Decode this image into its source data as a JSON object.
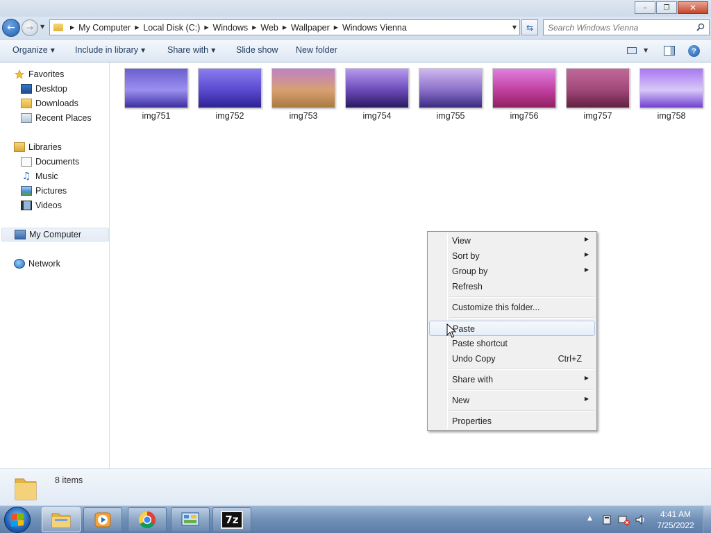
{
  "window": {
    "buttons": {
      "minimize": "minimize",
      "maximize": "maximize",
      "close": "close"
    }
  },
  "address": {
    "crumbs": [
      "My Computer",
      "Local Disk (C:)",
      "Windows",
      "Web",
      "Wallpaper",
      "Windows Vienna"
    ],
    "search_placeholder": "Search Windows Vienna"
  },
  "toolbar": {
    "organize": "Organize",
    "include_in_library": "Include in library",
    "share_with": "Share with",
    "slide_show": "Slide show",
    "new_folder": "New folder"
  },
  "nav": {
    "favorites": "Favorites",
    "desktop": "Desktop",
    "downloads": "Downloads",
    "recent_places": "Recent Places",
    "libraries": "Libraries",
    "documents": "Documents",
    "music": "Music",
    "pictures": "Pictures",
    "videos": "Videos",
    "my_computer": "My Computer",
    "network": "Network"
  },
  "files": [
    {
      "name": "img751",
      "colors": [
        "#6a5fd0",
        "#9c8ff0",
        "#3c2fa0"
      ]
    },
    {
      "name": "img752",
      "colors": [
        "#8a7cf0",
        "#5a4ad0",
        "#2e2290"
      ]
    },
    {
      "name": "img753",
      "colors": [
        "#c080c8",
        "#d8a070",
        "#a87a40"
      ]
    },
    {
      "name": "img754",
      "colors": [
        "#b89af0",
        "#6a4ab8",
        "#2a1a60"
      ]
    },
    {
      "name": "img755",
      "colors": [
        "#d0b8f0",
        "#8a70c8",
        "#3a2a80"
      ]
    },
    {
      "name": "img756",
      "colors": [
        "#e080e0",
        "#c040a0",
        "#902060"
      ]
    },
    {
      "name": "img757",
      "colors": [
        "#c06898",
        "#a04878",
        "#602040"
      ]
    },
    {
      "name": "img758",
      "colors": [
        "#a878f0",
        "#d8c8f8",
        "#7040d0"
      ]
    }
  ],
  "status": {
    "item_count": "8 items"
  },
  "context_menu": {
    "view": "View",
    "sort_by": "Sort by",
    "group_by": "Group by",
    "refresh": "Refresh",
    "customize": "Customize this folder...",
    "paste": "Paste",
    "paste_shortcut": "Paste shortcut",
    "undo_copy": "Undo Copy",
    "undo_copy_shortcut": "Ctrl+Z",
    "share_with": "Share with",
    "new": "New",
    "properties": "Properties"
  },
  "taskbar": {
    "clock_time": "4:41 AM",
    "clock_date": "7/25/2022",
    "sevenzip_label": "7z"
  }
}
